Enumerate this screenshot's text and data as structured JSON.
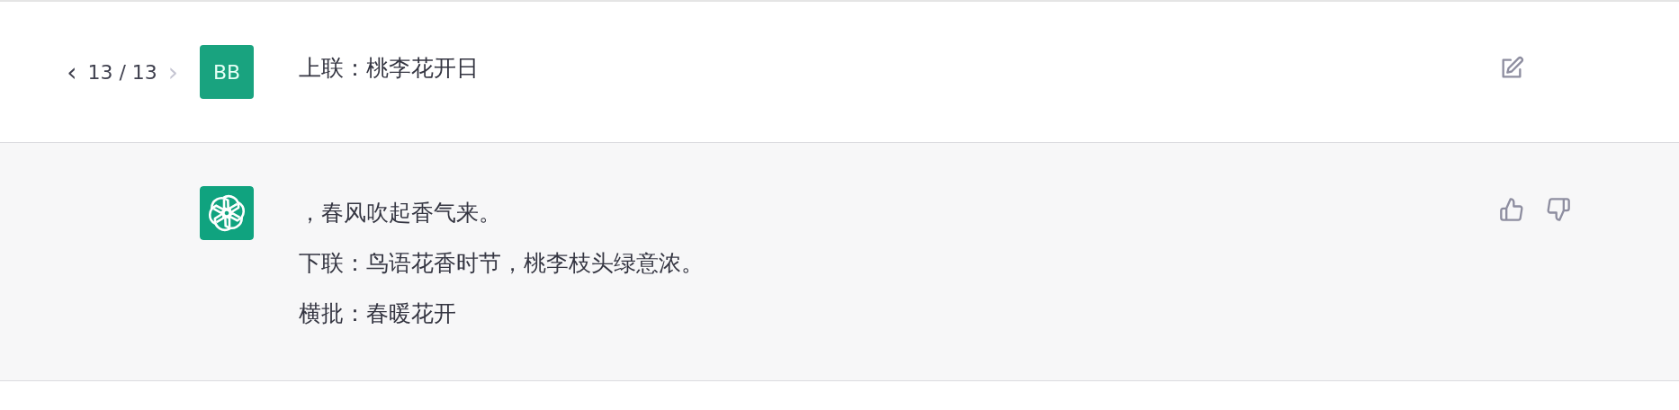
{
  "messages": [
    {
      "kind": "user",
      "pager": {
        "prev": {
          "label": "‹",
          "disabled": false
        },
        "count": "13 / 13",
        "next": {
          "label": "›",
          "disabled": true
        }
      },
      "avatar": "BB",
      "lines": [
        "上联：桃李花开日"
      ]
    },
    {
      "kind": "assistant",
      "lines": [
        "，春风吹起香气来。",
        "下联：鸟语花香时节，桃李枝头绿意浓。",
        "横批：春暖花开"
      ]
    }
  ]
}
